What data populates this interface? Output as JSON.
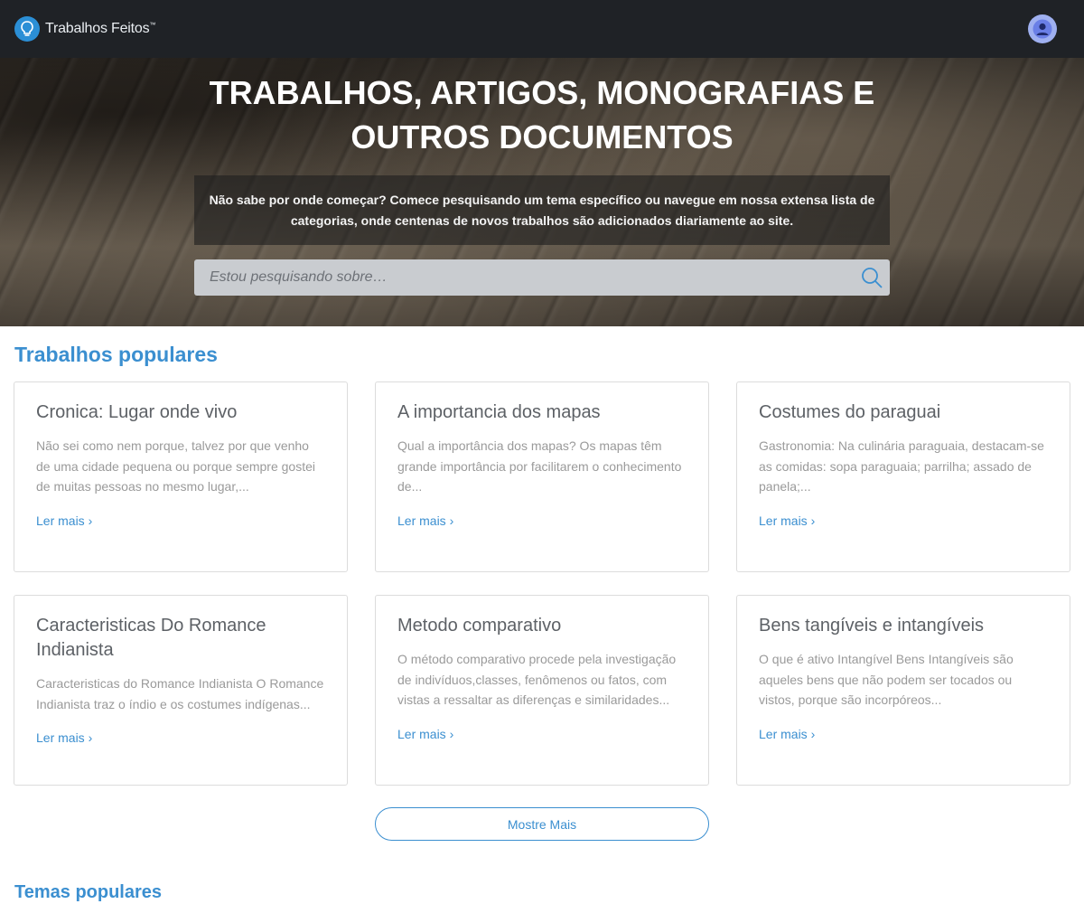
{
  "header": {
    "logo_text": "Trabalhos Feitos",
    "logo_mark": "™"
  },
  "hero": {
    "title_line1": "TRABALHOS, ARTIGOS, MONOGRAFIAS E",
    "title_line2": "OUTROS DOCUMENTOS",
    "description": "Não sabe por onde começar? Comece pesquisando um tema específico ou navegue em nossa extensa lista de categorias, onde centenas de novos trabalhos são adicionados diariamente ao site.",
    "search_placeholder": "Estou pesquisando sobre…"
  },
  "popular": {
    "title": "Trabalhos populares",
    "cards": [
      {
        "title": "Cronica: Lugar onde vivo",
        "text": "Não sei como nem porque, talvez por que venho de uma cidade pequena ou porque sempre gostei de muitas pessoas no mesmo lugar,...",
        "link": "Ler mais ›"
      },
      {
        "title": "A importancia dos mapas",
        "text": "Qual a importância dos mapas? Os mapas têm grande importância por facilitarem o conhecimento de...",
        "link": "Ler mais ›"
      },
      {
        "title": "Costumes do paraguai",
        "text": "Gastronomia: Na culinária paraguaia, destacam-se as comidas: sopa paraguaia; parrilha; assado de panela;...",
        "link": "Ler mais ›"
      },
      {
        "title": "Caracteristicas Do Romance Indianista",
        "text": "Caracteristicas do Romance Indianista O Romance Indianista traz o índio e os costumes indígenas...",
        "link": "Ler mais ›"
      },
      {
        "title": "Metodo comparativo",
        "text": "O método comparativo procede pela investigação de indivíduos,classes, fenômenos ou fatos, com vistas a ressaltar as diferenças e similaridades...",
        "link": "Ler mais ›"
      },
      {
        "title": "Bens tangíveis e intangíveis",
        "text": "O que é ativo Intangível Bens Intangíveis são aqueles bens que não podem ser tocados ou vistos, porque são incorpóreos...",
        "link": "Ler mais ›"
      }
    ],
    "more_button": "Mostre Mais"
  },
  "topics": {
    "title": "Temas populares"
  },
  "colors": {
    "accent": "#3b8fd0",
    "topbar": "#1f2226"
  }
}
